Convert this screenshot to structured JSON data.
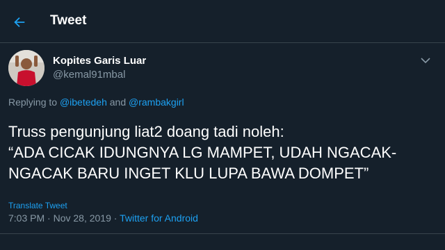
{
  "header": {
    "title": "Tweet",
    "back_icon": "arrow-left-icon"
  },
  "colors": {
    "background": "#15202b",
    "accent": "#1da1f2",
    "muted": "#8899a6",
    "divider": "#38444d"
  },
  "tweet": {
    "author_name": "Kopites Garis Luar",
    "author_handle": "@kemal91mbal",
    "reply_prefix": "Replying to ",
    "reply_mention_1": "@ibetedeh",
    "reply_and": " and ",
    "reply_mention_2": "@rambakgirl",
    "text_line_1": "Truss pengunjung liat2 doang tadi noleh:",
    "text_line_2": "“ADA CICAK IDUNGNYA LG MAMPET, UDAH NGACAK-",
    "text_line_3": "NGACAK BARU INGET KLU LUPA BAWA DOMPET”",
    "translate_label": "Translate Tweet",
    "time": "7:03 PM",
    "separator": " · ",
    "date": "Nov 28, 2019",
    "separator_2": " · ",
    "source": "Twitter for Android",
    "menu_icon": "chevron-down-icon"
  }
}
